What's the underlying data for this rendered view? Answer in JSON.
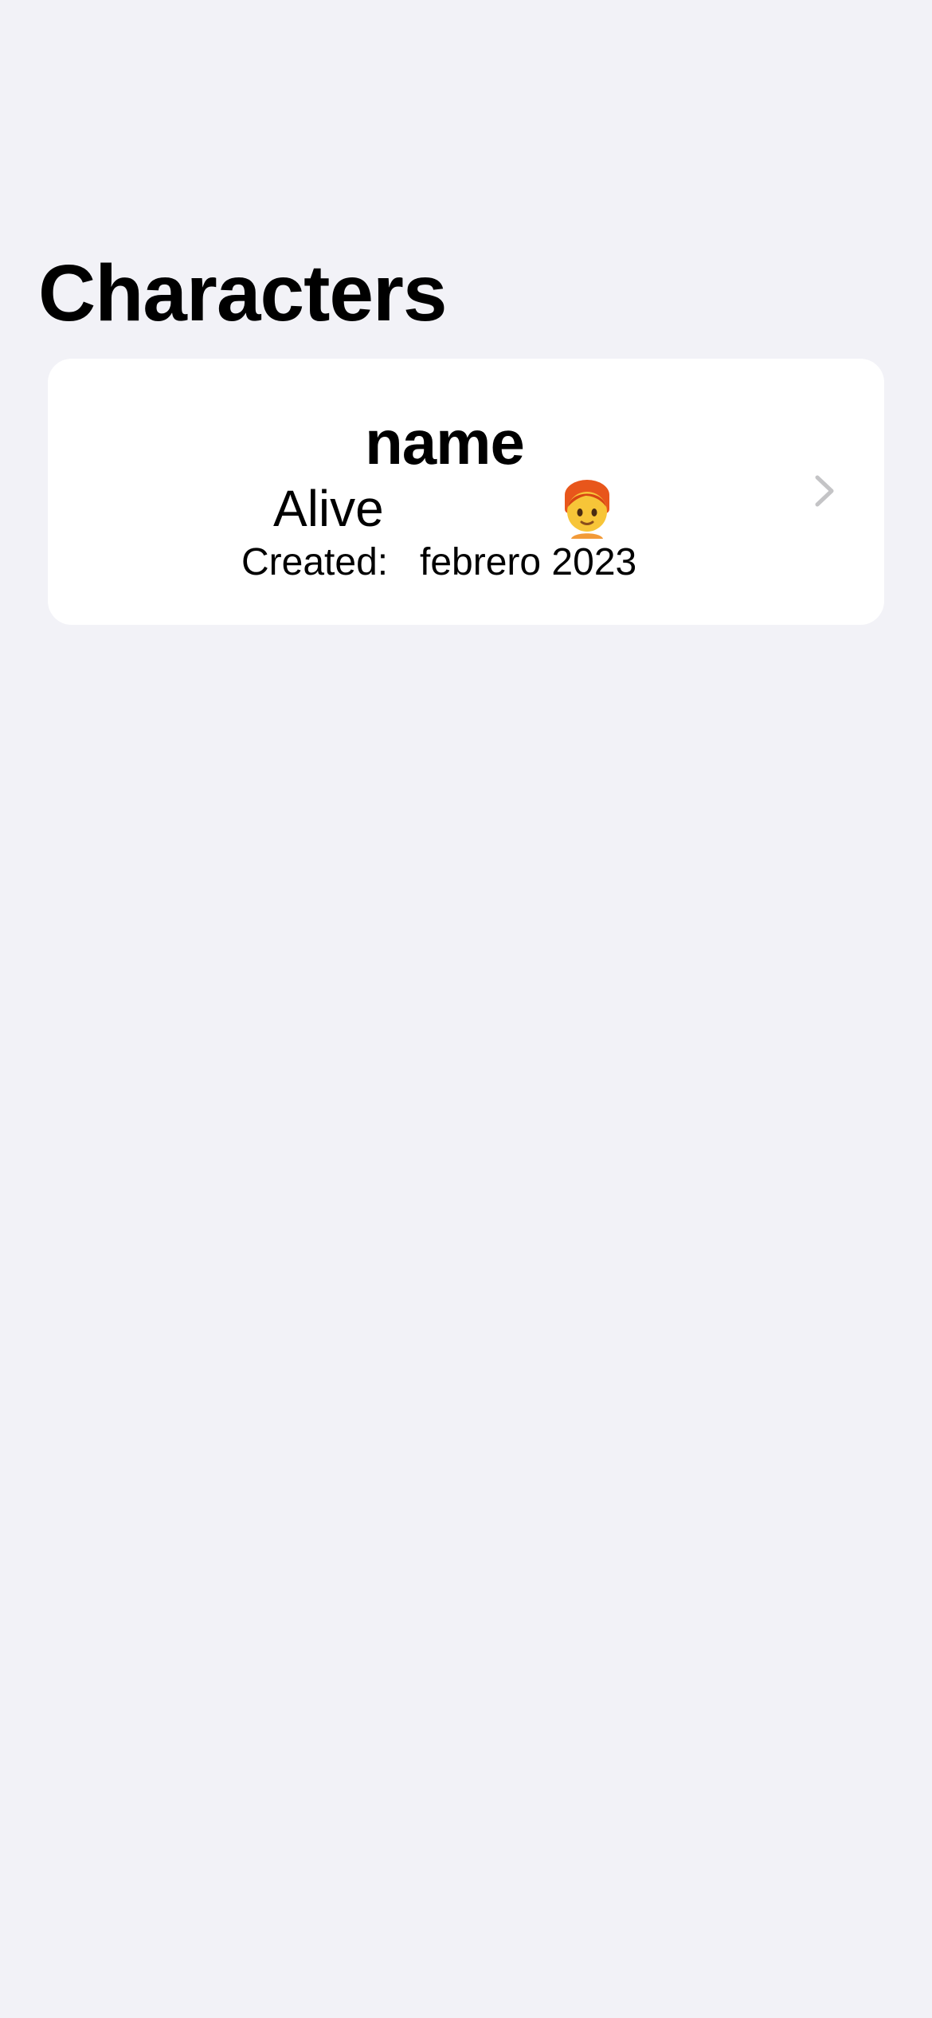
{
  "header": {
    "title": "Characters"
  },
  "characters": [
    {
      "name": "name",
      "status": "Alive",
      "avatar": "person-red-hair-emoji",
      "created_label": "Created:",
      "created_date": "febrero 2023",
      "accessory": "chevron-right-icon"
    }
  ],
  "colors": {
    "background": "#f2f2f7",
    "card": "#ffffff",
    "text": "#000000",
    "chevron": "#c4c4c6"
  }
}
